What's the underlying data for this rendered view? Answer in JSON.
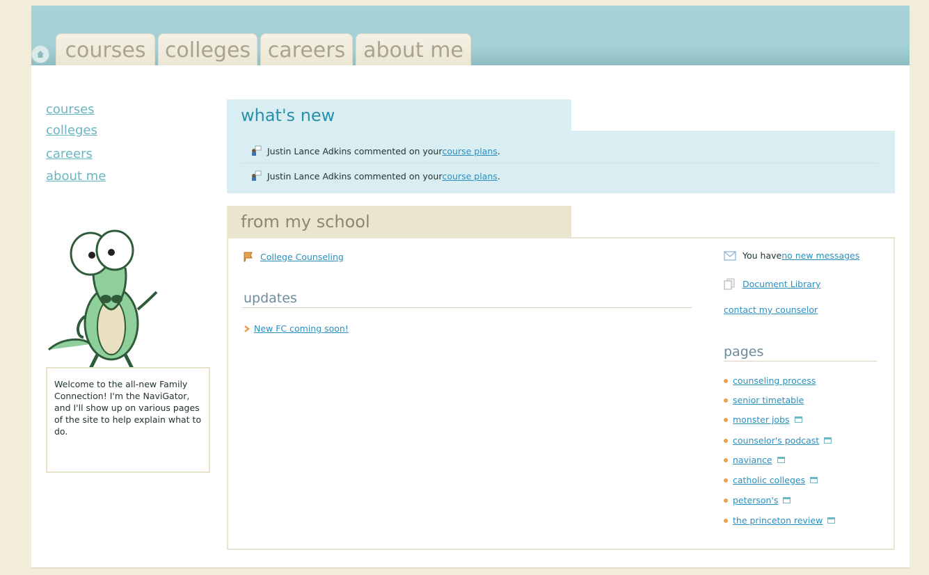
{
  "tabs": [
    "courses",
    "colleges",
    "careers",
    "about me"
  ],
  "left_nav": [
    "courses",
    "colleges",
    "careers",
    "about me"
  ],
  "navigator_text": "Welcome to the all-new Family Connection! I'm the NaviGator, and I'll show up on various pages of the site to help explain what to do.",
  "whats_new": {
    "title": "what's new",
    "items": [
      {
        "text": "Justin Lance Adkins commented on your ",
        "link": "course plans",
        "suffix": "."
      },
      {
        "text": "Justin Lance Adkins commented on your ",
        "link": "course plans",
        "suffix": "."
      }
    ]
  },
  "from_my_school": {
    "title": "from my school",
    "counseling_link": "College Counseling",
    "updates_title": "updates",
    "update_link": "New FC coming soon!"
  },
  "sidebar": {
    "messages_prefix": "You have ",
    "messages_link": "no new messages",
    "document_library": "Document Library",
    "contact_counselor": "contact my counselor",
    "pages_title": "pages",
    "pages": [
      {
        "label": "counseling process",
        "external": false
      },
      {
        "label": "senior timetable",
        "external": false
      },
      {
        "label": "monster jobs",
        "external": true
      },
      {
        "label": "counselor's podcast",
        "external": true
      },
      {
        "label": "naviance",
        "external": true
      },
      {
        "label": "catholic colleges",
        "external": true
      },
      {
        "label": "peterson's",
        "external": true
      },
      {
        "label": "the princeton review",
        "external": true
      }
    ]
  },
  "colors": {
    "header": "#a6d2d8",
    "link": "#2a8fbf",
    "accent": "#2a8fa8",
    "school_head": "#e9e5cf"
  },
  "icons": [
    "home-icon",
    "comment-icon",
    "flag-icon",
    "chevron-right-icon",
    "mail-icon",
    "documents-icon",
    "bullet-icon",
    "external-window-icon"
  ]
}
